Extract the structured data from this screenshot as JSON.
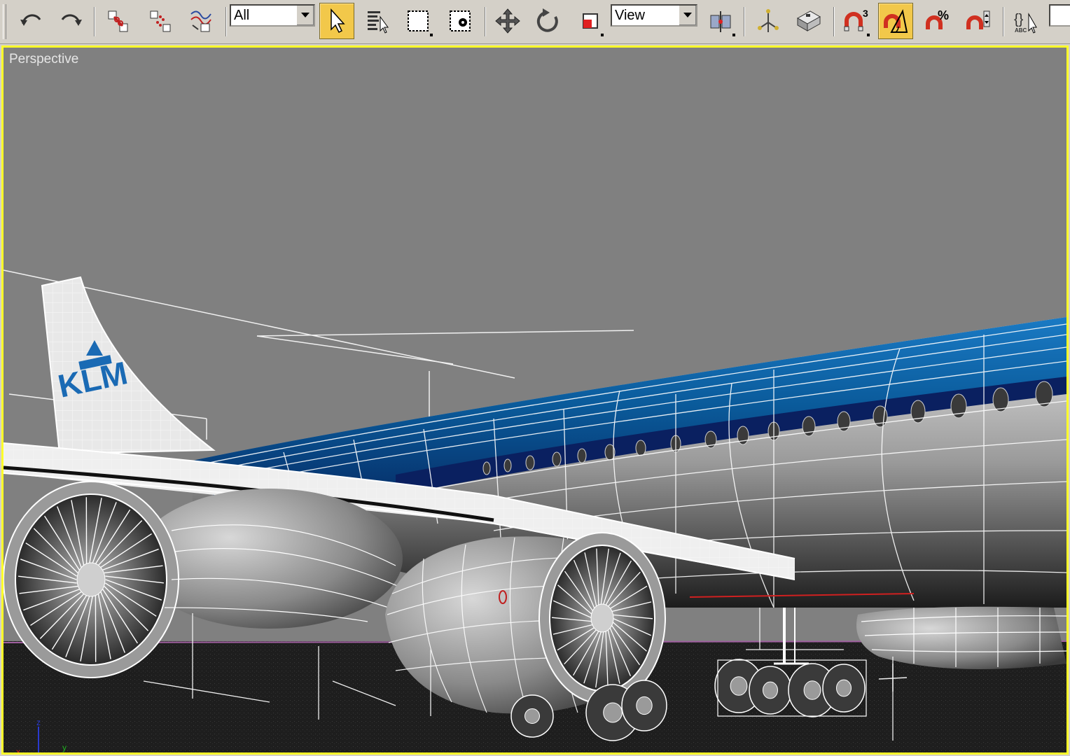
{
  "toolbar": {
    "selection_filter": {
      "value": "All"
    },
    "reference_coord": {
      "value": "View"
    },
    "snap_count": "3",
    "percent_snap": "%",
    "buttons": [
      {
        "name": "undo",
        "icon": "undo-icon"
      },
      {
        "name": "redo",
        "icon": "redo-icon"
      },
      {
        "name": "select-and-link",
        "icon": "link-icon"
      },
      {
        "name": "unlink-selection",
        "icon": "unlink-icon"
      },
      {
        "name": "bind-to-space-warp",
        "icon": "space-warp-icon"
      },
      {
        "name": "select-object",
        "icon": "arrow-cursor-icon",
        "active": true
      },
      {
        "name": "select-by-name",
        "icon": "select-by-name-icon"
      },
      {
        "name": "rectangular-selection-region",
        "icon": "rect-region-icon"
      },
      {
        "name": "window-crossing",
        "icon": "window-crossing-icon"
      },
      {
        "name": "select-and-move",
        "icon": "move-icon"
      },
      {
        "name": "select-and-rotate",
        "icon": "rotate-icon"
      },
      {
        "name": "select-and-scale",
        "icon": "scale-icon"
      },
      {
        "name": "use-pivot-point-center",
        "icon": "pivot-center-icon"
      },
      {
        "name": "select-and-manipulate",
        "icon": "manipulate-icon"
      },
      {
        "name": "keyboard-shortcut-override",
        "icon": "keyboard-icon"
      },
      {
        "name": "snaps-toggle",
        "icon": "magnet-3-icon"
      },
      {
        "name": "angle-snap-toggle",
        "icon": "angle-snap-icon",
        "active": true
      },
      {
        "name": "percent-snap-toggle",
        "icon": "percent-snap-icon"
      },
      {
        "name": "spinner-snap-toggle",
        "icon": "spinner-snap-icon"
      },
      {
        "name": "edit-named-selection-sets",
        "icon": "named-selection-icon"
      }
    ],
    "named_selection_abbr": "ABC"
  },
  "viewport": {
    "label": "Perspective",
    "border_color": "#ffff29",
    "background_color": "#808080",
    "ground_color": "#202020"
  },
  "scene": {
    "tail_logo_text": "KLM",
    "livery_color": "#0a5a9a",
    "livery_dark": "#0a2060"
  },
  "axis_tripod": {
    "x": "x",
    "y": "y",
    "z": "z"
  }
}
